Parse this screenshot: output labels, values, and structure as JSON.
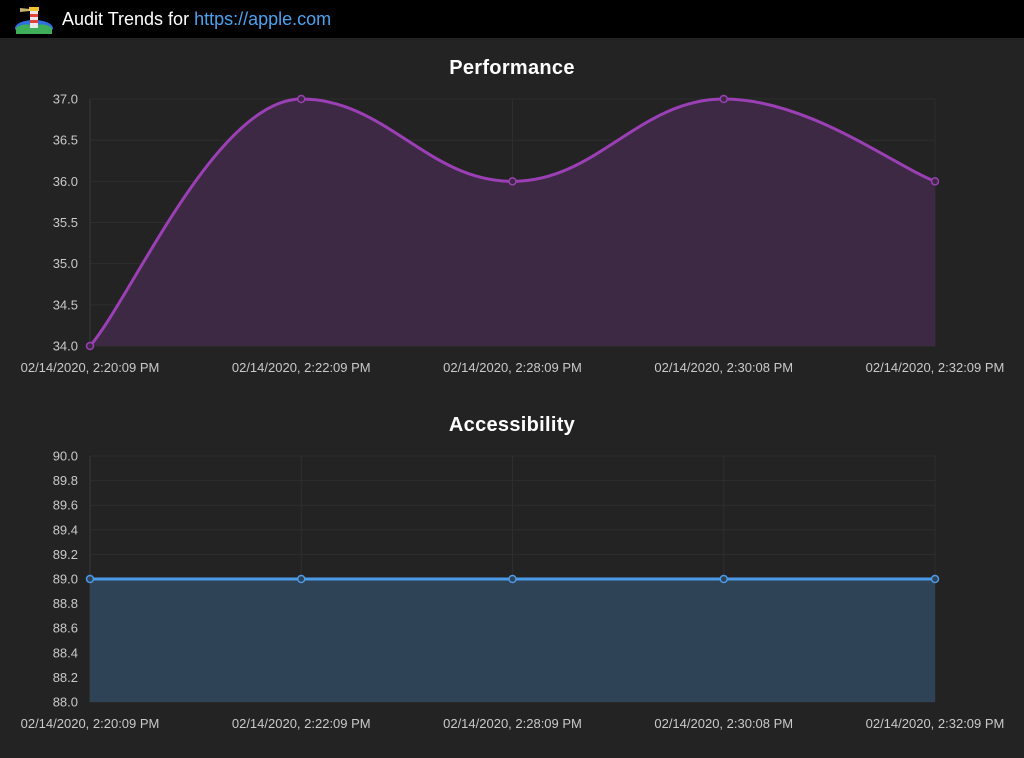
{
  "header": {
    "prefix": "Audit Trends for ",
    "url": "https://apple.com"
  },
  "chart_data": [
    {
      "type": "area",
      "title": "Performance",
      "x": [
        "02/14/2020, 2:20:09 PM",
        "02/14/2020, 2:22:09 PM",
        "02/14/2020, 2:28:09 PM",
        "02/14/2020, 2:30:08 PM",
        "02/14/2020, 2:32:09 PM"
      ],
      "values": [
        34.0,
        37.0,
        36.0,
        37.0,
        36.0
      ],
      "ylim": [
        34.0,
        37.0
      ],
      "yticks": [
        "37.0",
        "36.5",
        "36.0",
        "35.5",
        "35.0",
        "34.5",
        "34.0"
      ],
      "line_color": "#9b3fb5",
      "fill_color": "#3d2943",
      "smooth": true,
      "grid": true
    },
    {
      "type": "area",
      "title": "Accessibility",
      "x": [
        "02/14/2020, 2:20:09 PM",
        "02/14/2020, 2:22:09 PM",
        "02/14/2020, 2:28:09 PM",
        "02/14/2020, 2:30:08 PM",
        "02/14/2020, 2:32:09 PM"
      ],
      "values": [
        89.0,
        89.0,
        89.0,
        89.0,
        89.0
      ],
      "ylim": [
        88.0,
        90.0
      ],
      "yticks": [
        "90.0",
        "89.8",
        "89.6",
        "89.4",
        "89.2",
        "89.0",
        "88.8",
        "88.6",
        "88.4",
        "88.2",
        "88.0"
      ],
      "line_color": "#4c9be8",
      "fill_color": "#2e4355",
      "smooth": false,
      "grid": true
    }
  ]
}
